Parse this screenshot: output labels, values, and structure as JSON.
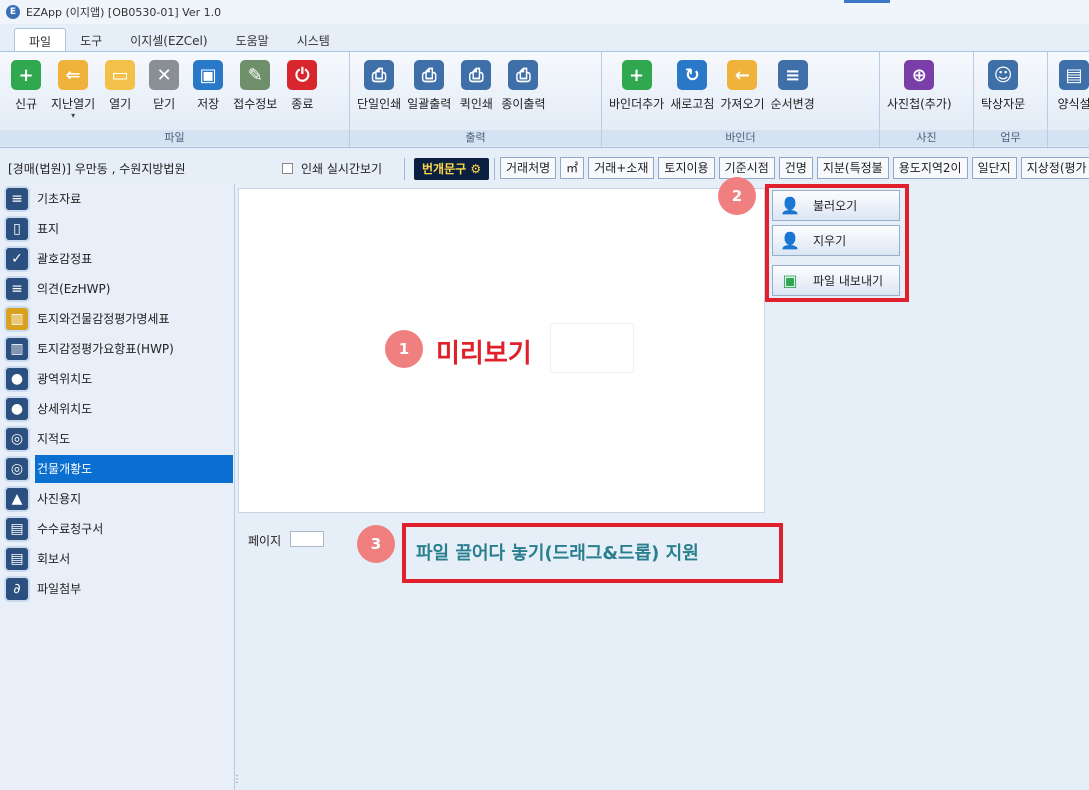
{
  "window": {
    "title": "EZApp (이지앱) [OB0530-01] Ver 1.0"
  },
  "menu_tabs": [
    {
      "label": "파일",
      "active": true
    },
    {
      "label": "도구",
      "active": false
    },
    {
      "label": "이지셀(EZCel)",
      "active": false
    },
    {
      "label": "도움말",
      "active": false
    },
    {
      "label": "시스템",
      "active": false
    }
  ],
  "ribbon": {
    "file_group": {
      "label": "파일",
      "buttons": [
        "신규",
        "지난열기",
        "열기",
        "닫기",
        "저장",
        "접수정보",
        "종료"
      ]
    },
    "print_group": {
      "label": "출력",
      "buttons": [
        "단일인쇄",
        "일괄출력",
        "퀵인쇄",
        "종이출력"
      ]
    },
    "binder_group": {
      "label": "바인더",
      "buttons": [
        "바인더추가",
        "새로고침",
        "가져오기",
        "순서변경"
      ]
    },
    "photo_group": {
      "label": "사진",
      "buttons": [
        "사진첩(추가)"
      ]
    },
    "work_group": {
      "label": "업무",
      "buttons": [
        "탁상자문"
      ]
    },
    "extra_group": {
      "buttons": [
        "양식설"
      ]
    }
  },
  "subbar": {
    "court": "[경매(법원)] 우만동 , 수원지방법원",
    "realtime_print_label": "인쇄 실시간보기",
    "bungae_label": "번개문구",
    "chips": [
      "거래처명",
      "㎡",
      "거래+소재",
      "토지이용",
      "기준시점",
      "건명",
      "지분(특정불",
      "용도지역2이",
      "일단지",
      "지상정(평가"
    ]
  },
  "sidebar": {
    "items": [
      {
        "label": "기초자료",
        "icon": "≡"
      },
      {
        "label": "표지",
        "icon": "▯"
      },
      {
        "label": "괄호감정표",
        "icon": "✓"
      },
      {
        "label": "의견(EzHWP)",
        "icon": "≡"
      },
      {
        "label": "토지와건물감정평가명세표",
        "icon": "▥"
      },
      {
        "label": "토지감정평가요항표(HWP)",
        "icon": "▥"
      },
      {
        "label": "광역위치도",
        "icon": "●"
      },
      {
        "label": "상세위치도",
        "icon": "●"
      },
      {
        "label": "지적도",
        "icon": "◎"
      },
      {
        "label": "건물개황도",
        "icon": "◎"
      },
      {
        "label": "사진용지",
        "icon": "▲"
      },
      {
        "label": "수수료청구서",
        "icon": "▤"
      },
      {
        "label": "회보서",
        "icon": "▤"
      },
      {
        "label": "파일첨부",
        "icon": "∂"
      }
    ],
    "active_index": 9
  },
  "preview": {
    "page_label": "페이지"
  },
  "actions": {
    "load": "불러오기",
    "clear": "지우기",
    "export": "파일 내보내기"
  },
  "annotations": {
    "badge1": "1",
    "text1": "미리보기",
    "badge2": "2",
    "badge3": "3",
    "text3": "파일 끌어다 놓기(드래그&드롭) 지원"
  },
  "colors": {
    "annotation_red": "#e0202a",
    "annotation_text": "#2a7f8f",
    "selected": "#0a6fd1",
    "badge": "#f08080"
  }
}
